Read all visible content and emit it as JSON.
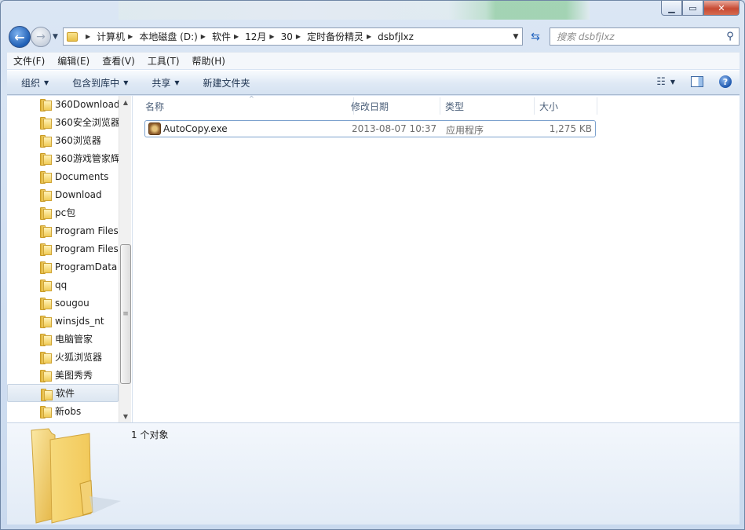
{
  "window": {
    "caption_buttons": {
      "minimize": "▁",
      "maximize": "▭",
      "close": "✕"
    }
  },
  "address": {
    "crumbs": [
      "计算机",
      "本地磁盘 (D:)",
      "软件",
      "12月",
      "30",
      "定时备份精灵",
      "dsbfjlxz"
    ]
  },
  "search": {
    "placeholder": "搜索 dsbfjlxz"
  },
  "menu": [
    "文件(F)",
    "编辑(E)",
    "查看(V)",
    "工具(T)",
    "帮助(H)"
  ],
  "toolbar": {
    "organize": "组织",
    "include": "包含到库中",
    "share": "共享",
    "new_folder": "新建文件夹"
  },
  "nav": {
    "items": [
      "360Download",
      "360安全浏览器",
      "360浏览器",
      "360游戏管家辉",
      "Documents",
      "Download",
      "pc包",
      "Program Files",
      "Program Files",
      "ProgramData",
      "qq",
      "sougou",
      "winsjds_nt",
      "电脑管家",
      "火狐浏览器",
      "美图秀秀",
      "软件",
      "新obs"
    ],
    "selected": "软件"
  },
  "columns": {
    "name": "名称",
    "date": "修改日期",
    "type": "类型",
    "size": "大小"
  },
  "files": [
    {
      "name": "AutoCopy.exe",
      "date": "2013-08-07 10:37",
      "type": "应用程序",
      "size": "1,275 KB"
    }
  ],
  "status": {
    "count": "1 个对象"
  }
}
